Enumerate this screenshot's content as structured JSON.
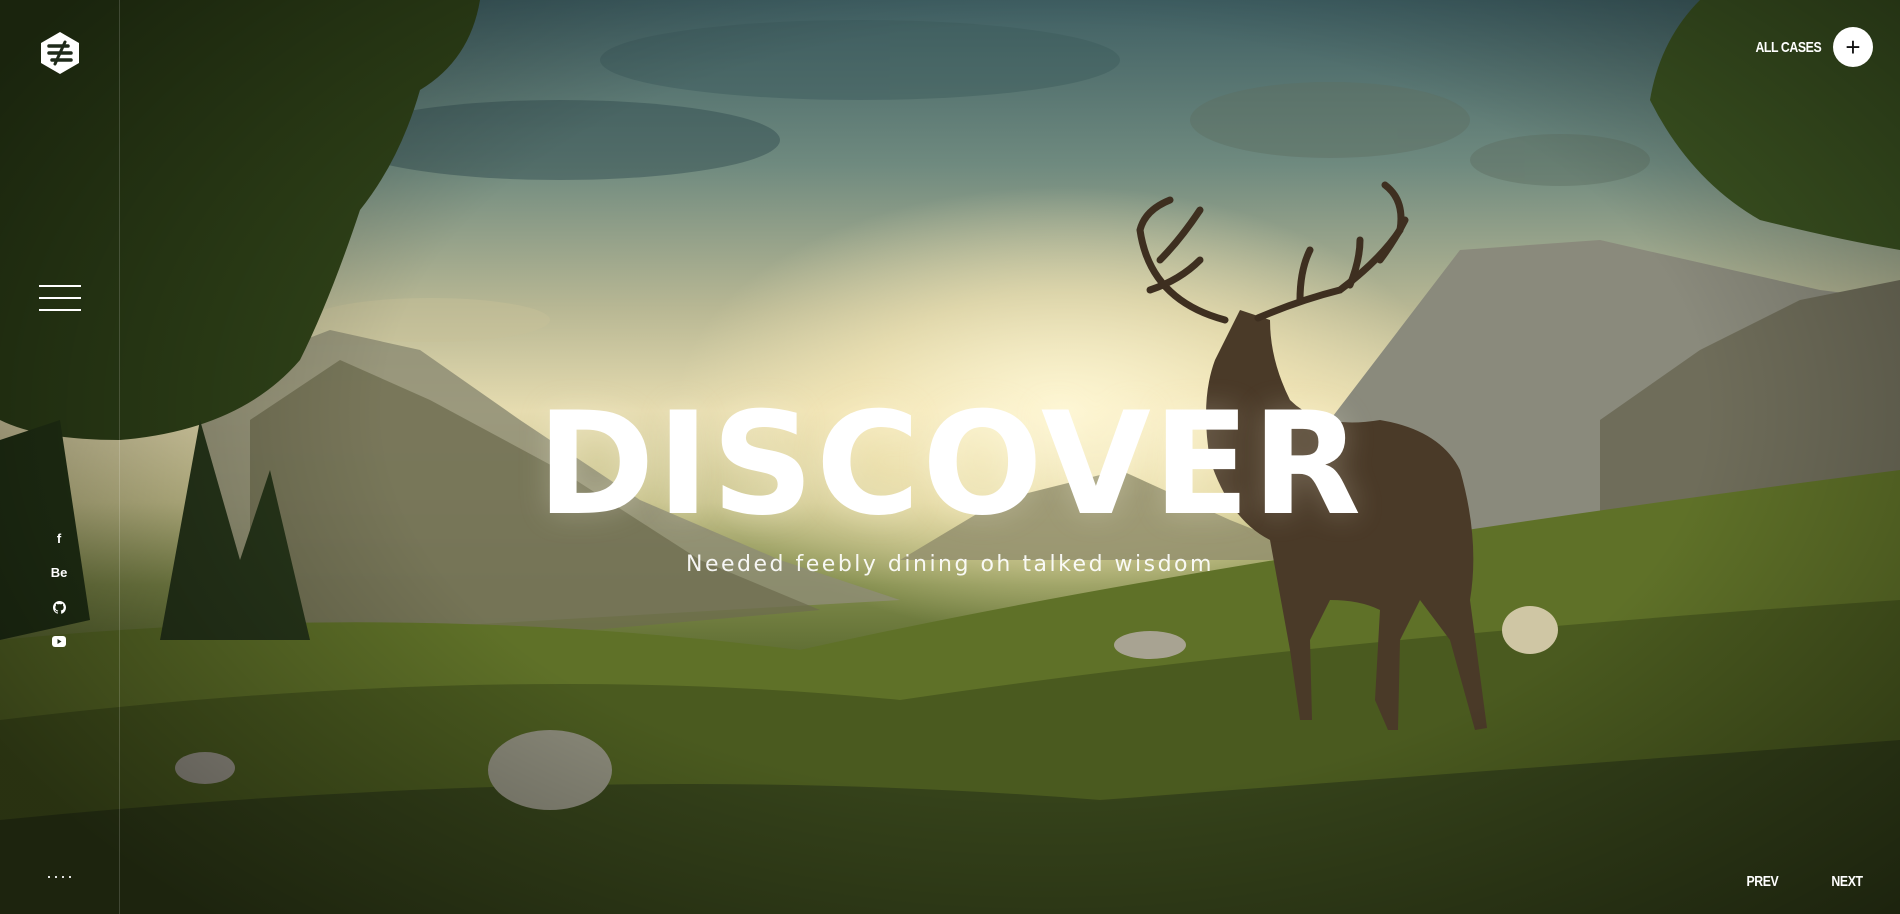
{
  "hero": {
    "title": "DISCOVER",
    "subtitle": "Needed feebly dining oh talked wisdom",
    "background_image": "deer-in-mountain-valley-landscape"
  },
  "header": {
    "logo_icon": "brand-logo-icon",
    "all_cases_label": "ALL CASES",
    "all_cases_button_icon": "plus-icon",
    "all_cases_button_glyph": "+"
  },
  "sidebar": {
    "menu_icon": "hamburger-menu-icon",
    "social": [
      {
        "name": "facebook",
        "glyph": "f"
      },
      {
        "name": "behance",
        "glyph": "Be"
      },
      {
        "name": "github",
        "glyph": "⬤"
      },
      {
        "name": "youtube",
        "glyph": "▶"
      }
    ],
    "more_glyph": "····"
  },
  "slider_nav": {
    "prev_label": "PREV",
    "next_label": "NEXT"
  },
  "colors": {
    "text": "#ffffff",
    "button_bg": "#ffffff",
    "button_fg": "#111111"
  }
}
